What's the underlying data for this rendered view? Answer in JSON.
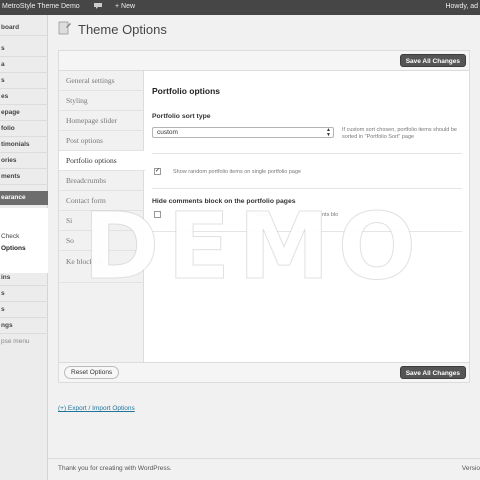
{
  "admin_bar": {
    "site_name": "MetroStyle Theme Demo",
    "new_label": "New",
    "howdy": "Howdy, ad"
  },
  "sidebar": {
    "items": [
      {
        "label": "board"
      },
      {
        "label": "s"
      },
      {
        "label": "a"
      },
      {
        "label": "s"
      },
      {
        "label": "es"
      },
      {
        "label": "epage"
      },
      {
        "label": "folio"
      },
      {
        "label": "timonials"
      },
      {
        "label": "ories"
      },
      {
        "label": "ments"
      },
      {
        "label": "earance"
      },
      {
        "label": "ins"
      },
      {
        "label": "s"
      },
      {
        "label": "s"
      },
      {
        "label": "ngs"
      }
    ],
    "submenu": [
      {
        "label": "Check"
      },
      {
        "label": "Options"
      }
    ],
    "collapse_label": "pse menu"
  },
  "page": {
    "title": "Theme Options"
  },
  "panel": {
    "save_label": "Save All Changes",
    "reset_label": "Reset Options"
  },
  "tabs": [
    {
      "label": "General settings"
    },
    {
      "label": "Styling"
    },
    {
      "label": "Homepage slider"
    },
    {
      "label": "Post options"
    },
    {
      "label": "Portfolio options"
    },
    {
      "label": "Breadcrumbs"
    },
    {
      "label": "Contact form"
    },
    {
      "label": "Si"
    },
    {
      "label": "So"
    },
    {
      "label": "Ke block co"
    }
  ],
  "content": {
    "section_title": "Portfolio options",
    "sort_type_label": "Portfolio sort type",
    "sort_value": "custom",
    "sort_help": "If custom sort chosen, portfolio items should be sorted in \"Portfolio Sort\" page",
    "random_label": "Show random portfolio items on single portfolio page",
    "random_checked": true,
    "hide_comments_title": "Hide comments block on the portfolio pages",
    "hide_comments_label_a": "t to l",
    "hide_comments_label_b": "nts blo"
  },
  "export_link": "(+) Export / Import Options",
  "footer": {
    "thanks": "Thank you for creating with WordPress.",
    "version": "Versio"
  },
  "watermark": "DEMO",
  "colors": {
    "admin_bar": "#464646",
    "active_menu": "#6d6d6d",
    "save_button": "#555555",
    "link": "#21759b"
  }
}
